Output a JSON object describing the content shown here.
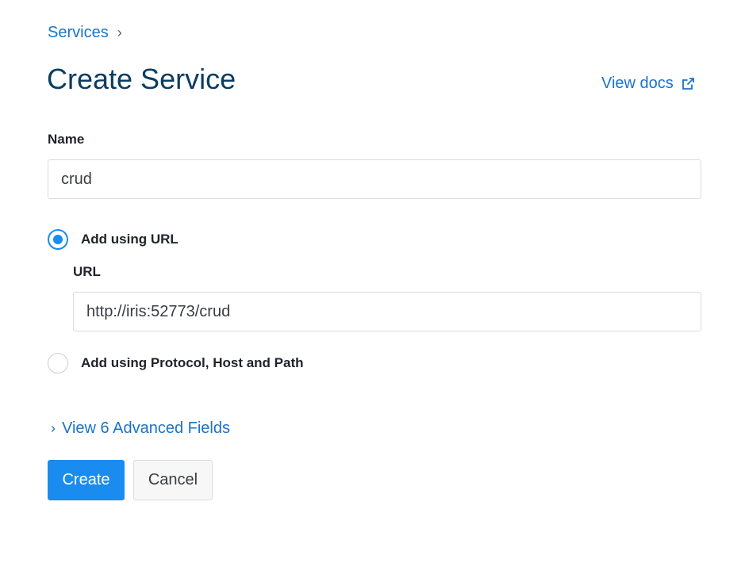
{
  "breadcrumb": {
    "parent": "Services",
    "separator": "›"
  },
  "page": {
    "title": "Create Service",
    "docs_link": "View docs"
  },
  "form": {
    "name_label": "Name",
    "name_value": "crud",
    "options": [
      {
        "label": "Add using URL",
        "selected": true
      },
      {
        "label": "Add using Protocol, Host and Path",
        "selected": false
      }
    ],
    "url_label": "URL",
    "url_value": "http://iris:52773/crud",
    "advanced_chevron": "›",
    "advanced_label": "View 6 Advanced Fields"
  },
  "actions": {
    "create_label": "Create",
    "cancel_label": "Cancel"
  },
  "colors": {
    "link": "#1a73c8",
    "title": "#0a3d62",
    "primary": "#1a8cf0"
  },
  "icons": {
    "docs": "external-link-icon",
    "advanced": "chevron-right-icon"
  }
}
